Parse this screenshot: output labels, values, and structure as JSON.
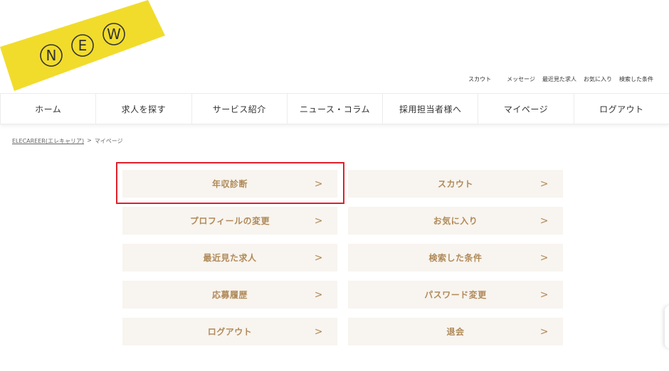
{
  "ribbon": {
    "letters": [
      "N",
      "E",
      "W"
    ],
    "color": "#f1dc2c"
  },
  "utility_links": [
    "スカウト",
    "メッセージ",
    "最近見た求人",
    "お気に入り",
    "検索した条件"
  ],
  "nav": [
    "ホーム",
    "求人を探す",
    "サービス紹介",
    "ニュース・コラム",
    "採用担当者様へ",
    "マイページ",
    "ログアウト"
  ],
  "breadcrumb": {
    "home": "ELECAREER(エレキャリア)",
    "separator": ">",
    "current": "マイページ"
  },
  "menu": [
    {
      "label": "年収診断",
      "chevron": ">"
    },
    {
      "label": "スカウト",
      "chevron": ">"
    },
    {
      "label": "プロフィールの変更",
      "chevron": ">"
    },
    {
      "label": "お気に入り",
      "chevron": ">"
    },
    {
      "label": "最近見た求人",
      "chevron": ">"
    },
    {
      "label": "検索した条件",
      "chevron": ">"
    },
    {
      "label": "応募履歴",
      "chevron": ">"
    },
    {
      "label": "パスワード変更",
      "chevron": ">"
    },
    {
      "label": "ログアウト",
      "chevron": ">"
    },
    {
      "label": "退会",
      "chevron": ">"
    }
  ],
  "colors": {
    "tile_bg": "#f8f4ef",
    "tile_text": "#b08a59",
    "highlight": "#e0202a"
  }
}
